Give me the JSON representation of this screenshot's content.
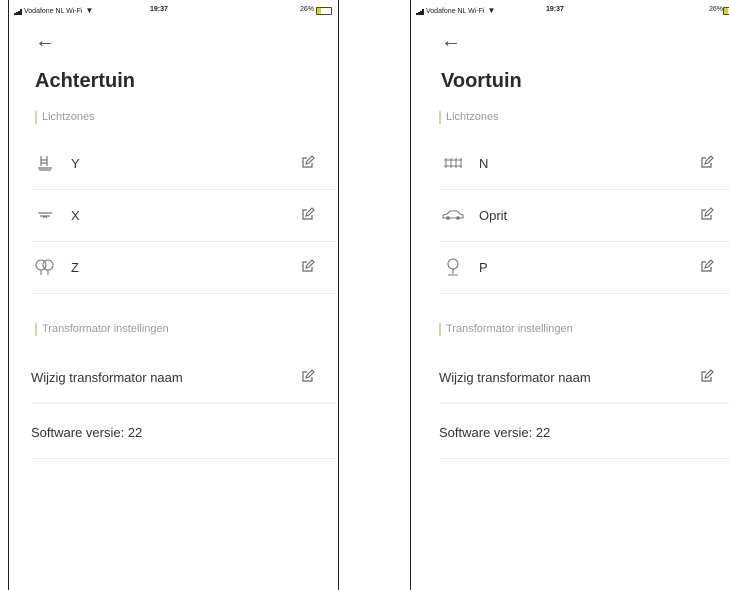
{
  "screens": [
    {
      "status": {
        "carrier": "Vodafone NL Wi-Fi",
        "time": "19:37",
        "battery": "26%",
        "battery_level": 0.26
      },
      "title": "Achtertuin",
      "lichtzones_label": "Lichtzones",
      "zones": [
        {
          "icon": "pool-ladder-icon",
          "label": "Y"
        },
        {
          "icon": "pond-icon",
          "label": "X"
        },
        {
          "icon": "trees-icon",
          "label": "Z"
        }
      ],
      "transformator_label": "Transformator instellingen",
      "rename_label": "Wijzig transformator naam",
      "software_label": "Software versie: 22"
    },
    {
      "status": {
        "carrier": "Vodafone NL Wi-Fi",
        "time": "19:37",
        "battery": "26%",
        "battery_level": 0.26
      },
      "title": "Voortuin",
      "lichtzones_label": "Lichtzones",
      "zones": [
        {
          "icon": "fence-icon",
          "label": "N"
        },
        {
          "icon": "car-icon",
          "label": "Oprit"
        },
        {
          "icon": "tree-icon",
          "label": "P"
        }
      ],
      "transformator_label": "Transformator instellingen",
      "rename_label": "Wijzig transformator naam",
      "software_label": "Software versie: 22"
    }
  ]
}
